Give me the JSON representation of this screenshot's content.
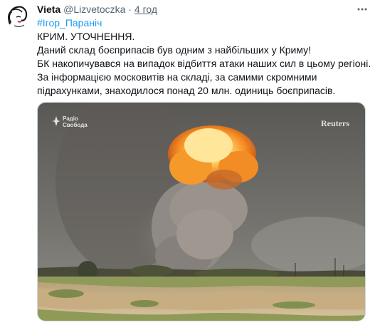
{
  "tweet": {
    "author_name": "Vieta",
    "author_handle": "@Lizvetoczka",
    "separator": "·",
    "time": "4 год",
    "hashtag": "#Ігор_Параніч",
    "lines": [
      "КРИМ. УТОЧНЕННЯ.",
      "Даний склад боєприпасів був одним з найбільших у Криму!",
      "БК накопичувався на випадок відбиття атаки наших сил в цьому регіоні.",
      "За інформацією московитів на складі, за  самими скромними",
      "підрахунками, знаходилося понад 20 млн. одиниць боєприпасів."
    ]
  },
  "media": {
    "watermark_left_line1": "Радіо",
    "watermark_left_line2": "Свобода",
    "watermark_right": "Reuters"
  },
  "icons": {
    "avatar": "avatar-sketch-icon",
    "more": "more-options-icon"
  },
  "colors": {
    "link": "#1d9bf0",
    "secondary_text": "#536471",
    "text": "#0f1419"
  }
}
